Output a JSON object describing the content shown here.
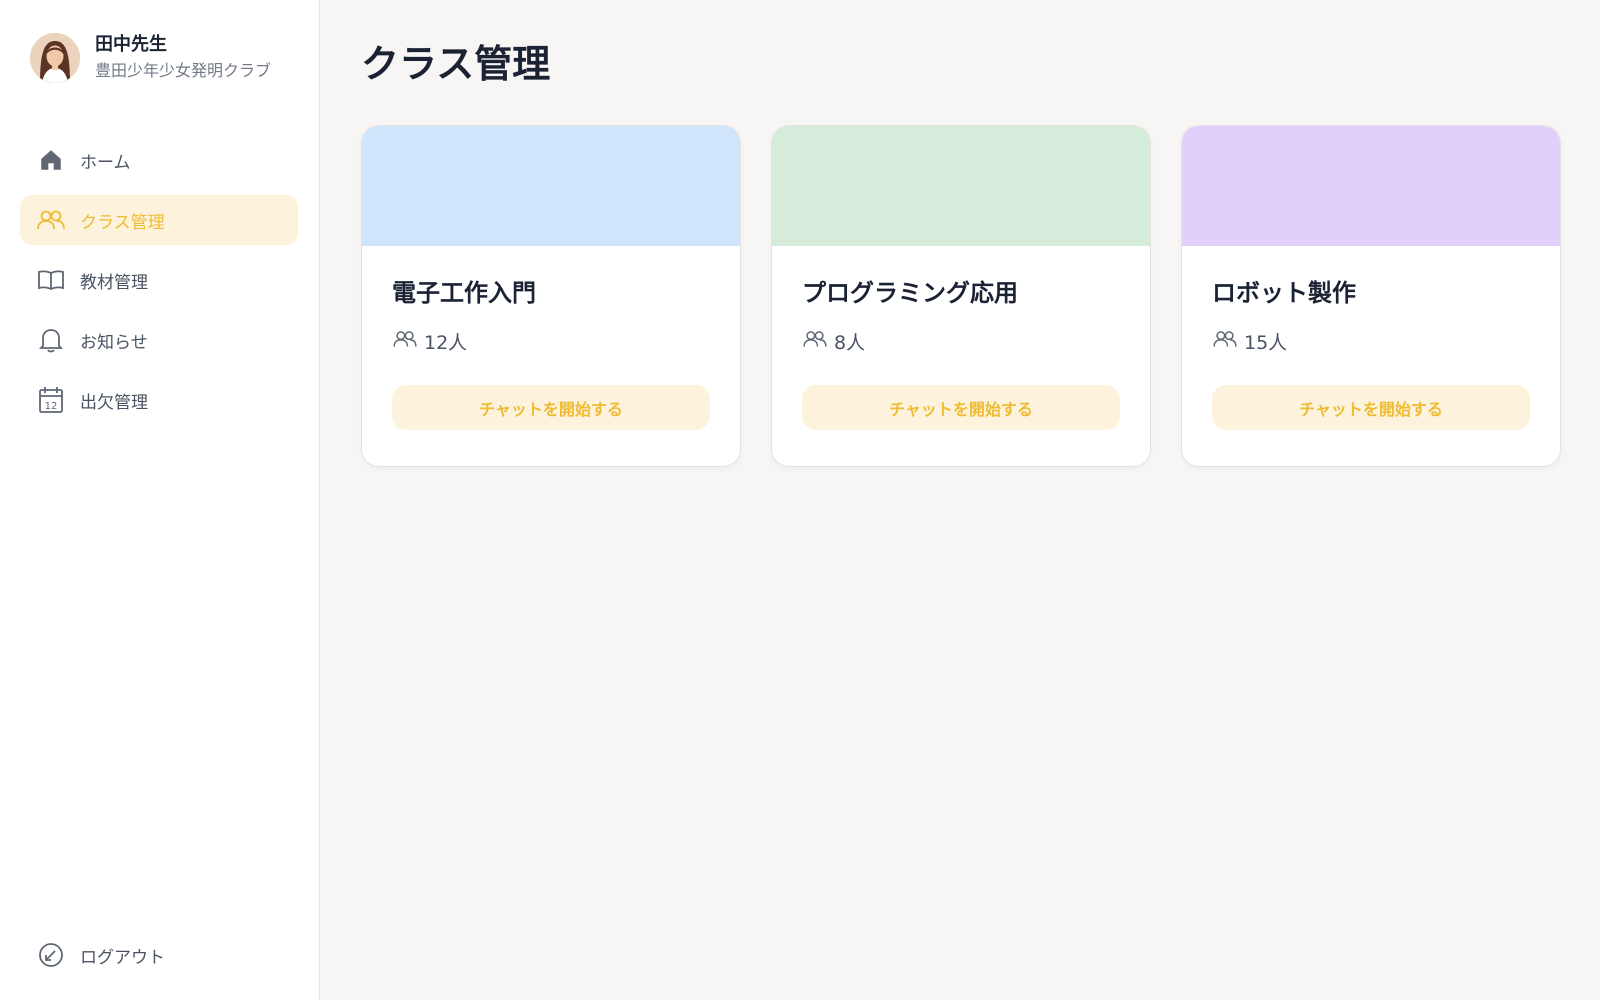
{
  "profile": {
    "name": "田中先生",
    "organization": "豊田少年少女発明クラブ"
  },
  "nav": {
    "items": [
      {
        "label": "ホーム",
        "icon": "home-icon",
        "active": false
      },
      {
        "label": "クラス管理",
        "icon": "users-icon",
        "active": true
      },
      {
        "label": "教材管理",
        "icon": "book-icon",
        "active": false
      },
      {
        "label": "お知らせ",
        "icon": "bell-icon",
        "active": false
      },
      {
        "label": "出欠管理",
        "icon": "calendar-icon",
        "active": false
      }
    ],
    "calendar_day": "12",
    "logout_label": "ログアウト"
  },
  "main": {
    "title": "クラス管理",
    "classes": [
      {
        "name": "電子工作入門",
        "count": "12人",
        "banner_color": "#cfe5fc",
        "button": "チャットを開始する"
      },
      {
        "name": "プログラミング応用",
        "count": "8人",
        "banner_color": "#d5ecdb",
        "button": "チャットを開始する"
      },
      {
        "name": "ロボット製作",
        "count": "15人",
        "banner_color": "#e1d0fb",
        "button": "チャットを開始する"
      }
    ]
  },
  "colors": {
    "accent": "#efbb33",
    "accent_bg": "#fdf3dc",
    "text": "#1a2233",
    "muted": "#737b87"
  }
}
